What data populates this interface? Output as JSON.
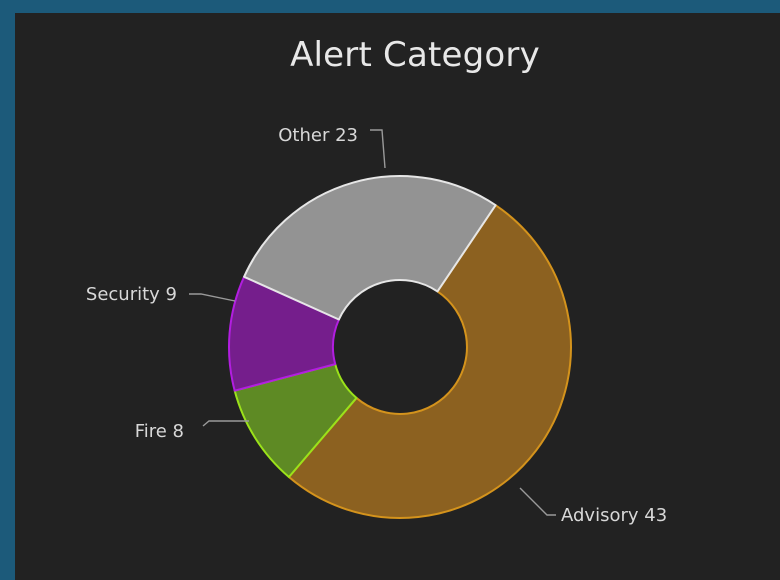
{
  "chart_data": {
    "type": "pie",
    "title": "Alert Category",
    "donut": true,
    "slices": [
      {
        "name": "Advisory",
        "value": 43,
        "label": "Advisory 43",
        "color": "#8c6120",
        "stroke": "#d4931c"
      },
      {
        "name": "Fire",
        "value": 8,
        "label": "Fire 8",
        "color": "#5e8a24",
        "stroke": "#9be21a"
      },
      {
        "name": "Security",
        "value": 9,
        "label": "Security 9",
        "color": "#751e8c",
        "stroke": "#b21ee0"
      },
      {
        "name": "Other",
        "value": 23,
        "label": "Other 23",
        "color": "#939393",
        "stroke": "#e6e6e6"
      }
    ]
  }
}
